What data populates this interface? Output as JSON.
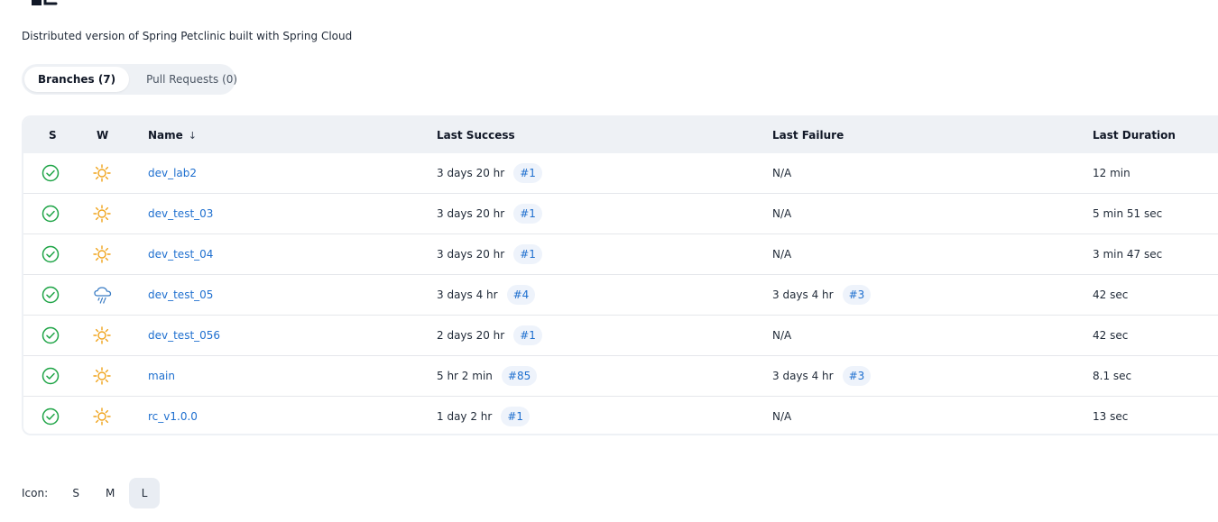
{
  "description": "Distributed version of Spring Petclinic built with Spring Cloud",
  "tabs": [
    {
      "label": "Branches (7)",
      "active": true
    },
    {
      "label": "Pull Requests (0)",
      "active": false
    }
  ],
  "table": {
    "headers": {
      "status": "S",
      "weather": "W",
      "name": "Name",
      "name_sort": "↓",
      "last_success": "Last Success",
      "last_failure": "Last Failure",
      "last_duration": "Last Duration"
    },
    "rows": [
      {
        "status": "success",
        "weather": "sunny",
        "name": "dev_lab2",
        "success_time": "3 days 20 hr",
        "success_build": "#1",
        "failure_time": "N/A",
        "failure_build": "",
        "duration": "12 min"
      },
      {
        "status": "success",
        "weather": "sunny",
        "name": "dev_test_03",
        "success_time": "3 days 20 hr",
        "success_build": "#1",
        "failure_time": "N/A",
        "failure_build": "",
        "duration": "5 min 51 sec"
      },
      {
        "status": "success",
        "weather": "sunny",
        "name": "dev_test_04",
        "success_time": "3 days 20 hr",
        "success_build": "#1",
        "failure_time": "N/A",
        "failure_build": "",
        "duration": "3 min 47 sec"
      },
      {
        "status": "success",
        "weather": "rainy",
        "name": "dev_test_05",
        "success_time": "3 days 4 hr",
        "success_build": "#4",
        "failure_time": "3 days 4 hr",
        "failure_build": "#3",
        "duration": "42 sec"
      },
      {
        "status": "success",
        "weather": "sunny",
        "name": "dev_test_056",
        "success_time": "2 days 20 hr",
        "success_build": "#1",
        "failure_time": "N/A",
        "failure_build": "",
        "duration": "42 sec"
      },
      {
        "status": "success",
        "weather": "sunny",
        "name": "main",
        "success_time": "5 hr 2 min",
        "success_build": "#85",
        "failure_time": "3 days 4 hr",
        "failure_build": "#3",
        "duration": "8.1 sec"
      },
      {
        "status": "success",
        "weather": "sunny",
        "name": "rc_v1.0.0",
        "success_time": "1 day 2 hr",
        "success_build": "#1",
        "failure_time": "N/A",
        "failure_build": "",
        "duration": "13 sec"
      }
    ]
  },
  "icon_size": {
    "label": "Icon:",
    "options": [
      "S",
      "M",
      "L"
    ],
    "selected": "L"
  },
  "colors": {
    "success": "#1ea446",
    "sunny": "#f0a41c",
    "rainy": "#3a7cc4",
    "link": "#1e6fcf"
  }
}
